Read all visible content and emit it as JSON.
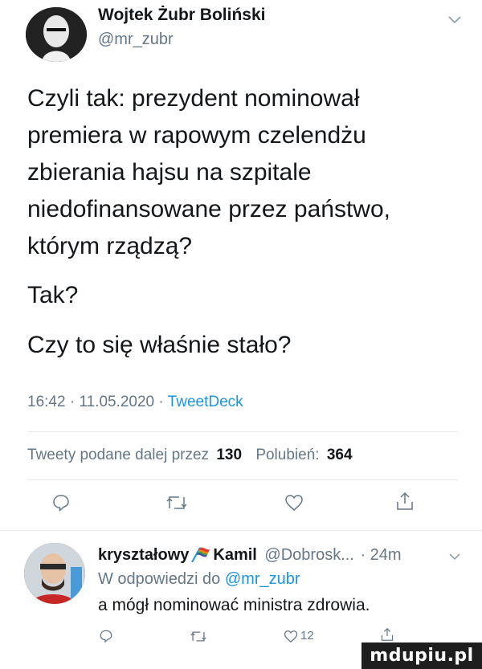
{
  "tweet": {
    "author_name": "Wojtek Żubr Boliński",
    "author_handle": "@mr_zubr",
    "text_lines": [
      "Czyli tak: prezydent nominował",
      "premiera w rapowym czelendżu",
      "zbierania hajsu na szpitale",
      "niedofinansowane przez państwo,",
      "którym rządzą?"
    ],
    "line_tak": "Tak?",
    "line_czy": "Czy to się właśnie stało?",
    "time": "16:42",
    "date": "11.05.2020",
    "source": "TweetDeck",
    "retweets_label": "Tweety podane dalej przez",
    "retweets_count": "130",
    "likes_label": "Polubień:",
    "likes_count": "364"
  },
  "reply": {
    "author_name": "kryształowy",
    "author_name_2": "Kamil",
    "author_handle": "@Dobrosk...",
    "time": "· 24m",
    "replying_to_prefix": "W odpowiedzi do",
    "replying_to_handle": "@mr_zubr",
    "text": "a mógł nominować ministra zdrowia.",
    "like_count": "12"
  },
  "watermark": "mdupiu.pl",
  "colors": {
    "link": "#1b95e0",
    "muted": "#657786",
    "text": "#14171a"
  },
  "icons": [
    "chevron-down-icon",
    "reply-icon",
    "retweet-icon",
    "like-icon",
    "share-icon",
    "rainbow-flag-icon"
  ]
}
